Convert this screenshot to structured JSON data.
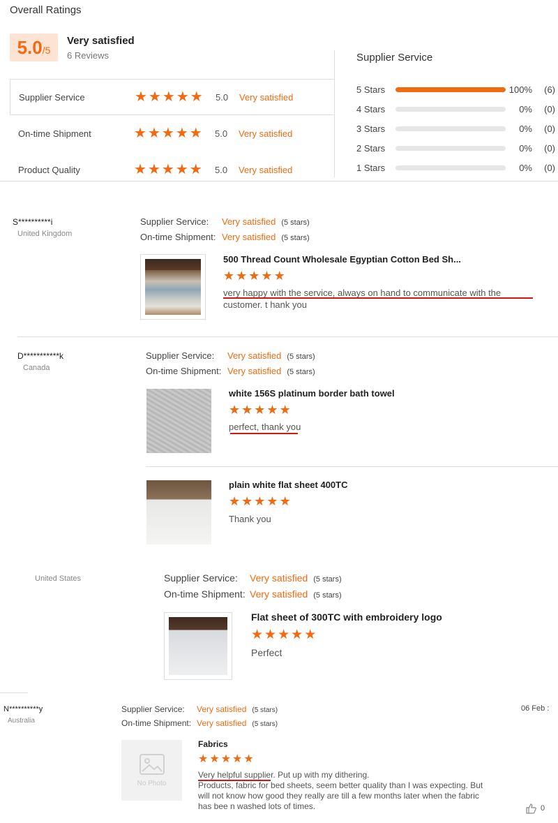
{
  "overall": {
    "title": "Overall Ratings",
    "score": "5.0",
    "score_suffix": "/5",
    "level": "Very satisfied",
    "reviews": "6 Reviews",
    "rows": [
      {
        "label": "Supplier Service",
        "score": "5.0",
        "level": "Very satisfied",
        "stars": 5
      },
      {
        "label": "On-time Shipment",
        "score": "5.0",
        "level": "Very satisfied",
        "stars": 5
      },
      {
        "label": "Product Quality",
        "score": "5.0",
        "level": "Very satisfied",
        "stars": 5
      }
    ]
  },
  "distribution": {
    "title": "Supplier Service",
    "rows": [
      {
        "label": "5  Stars",
        "fraction": 1.0,
        "pct": "100%",
        "count": "(6)"
      },
      {
        "label": "4  Stars",
        "fraction": 0.0,
        "pct": "0%",
        "count": "(0)"
      },
      {
        "label": "3  Stars",
        "fraction": 0.0,
        "pct": "0%",
        "count": "(0)"
      },
      {
        "label": "2  Stars",
        "fraction": 0.0,
        "pct": "0%",
        "count": "(0)"
      },
      {
        "label": "1  Stars",
        "fraction": 0.0,
        "pct": "0%",
        "count": "(0)"
      }
    ]
  },
  "reviews": [
    {
      "name": "S**********i",
      "country": "United Kingdom",
      "service_label": "Supplier Service:",
      "service_value": "Very satisfied",
      "service_stars": "(5 stars)",
      "shipment_label": "On-time Shipment:",
      "shipment_value": "Very satisfied",
      "shipment_stars": "(5 stars)",
      "products": [
        {
          "title": "500 Thread Count Wholesale Egyptian Cotton Bed Sh...",
          "text": "very happy with the service, always on hand to communicate with the customer. t hank you",
          "stars": 5
        }
      ]
    },
    {
      "name": "D***********k",
      "country": "Canada",
      "service_label": "Supplier Service:",
      "service_value": "Very satisfied",
      "service_stars": "(5 stars)",
      "shipment_label": "On-time Shipment:",
      "shipment_value": "Very satisfied",
      "shipment_stars": "(5 stars)",
      "products": [
        {
          "title": "white 156S platinum border bath towel",
          "text": "perfect, thank you",
          "stars": 5
        },
        {
          "title": "plain white flat sheet 400TC",
          "text": "Thank you",
          "stars": 5
        }
      ]
    },
    {
      "name": "",
      "country": "United States",
      "service_label": "Supplier Service:",
      "service_value": "Very satisfied",
      "service_stars": "(5 stars)",
      "shipment_label": "On-time Shipment:",
      "shipment_value": "Very satisfied",
      "shipment_stars": "(5 stars)",
      "products": [
        {
          "title": "Flat sheet of 300TC with embroidery logo",
          "text": "Perfect",
          "stars": 5
        }
      ]
    },
    {
      "name": "N**********y",
      "country": "Australia",
      "date": "06 Feb :",
      "service_label": "Supplier Service:",
      "service_value": "Very satisfied",
      "service_stars": "(5 stars)",
      "shipment_label": "On-time Shipment:",
      "shipment_value": "Very satisfied",
      "shipment_stars": "(5 stars)",
      "helpful_count": "0",
      "products": [
        {
          "title": "Fabrics",
          "text_line1": "Very helpful supplier. Put up with my dithering.",
          "text_line2": "Products, fabric for bed sheets, seem better quality than I was expecting. But will not know how good they really are till a few months later when the fabric has bee n washed lots of times.",
          "no_photo": "No Photo",
          "stars": 5
        }
      ]
    }
  ],
  "colors": {
    "accent": "#f26a10",
    "underline": "#d41616",
    "score_bg": "#fde3d3"
  },
  "icons": {
    "star": "star-icon",
    "thumb": "thumbs-up-icon",
    "photo": "image-placeholder-icon"
  }
}
